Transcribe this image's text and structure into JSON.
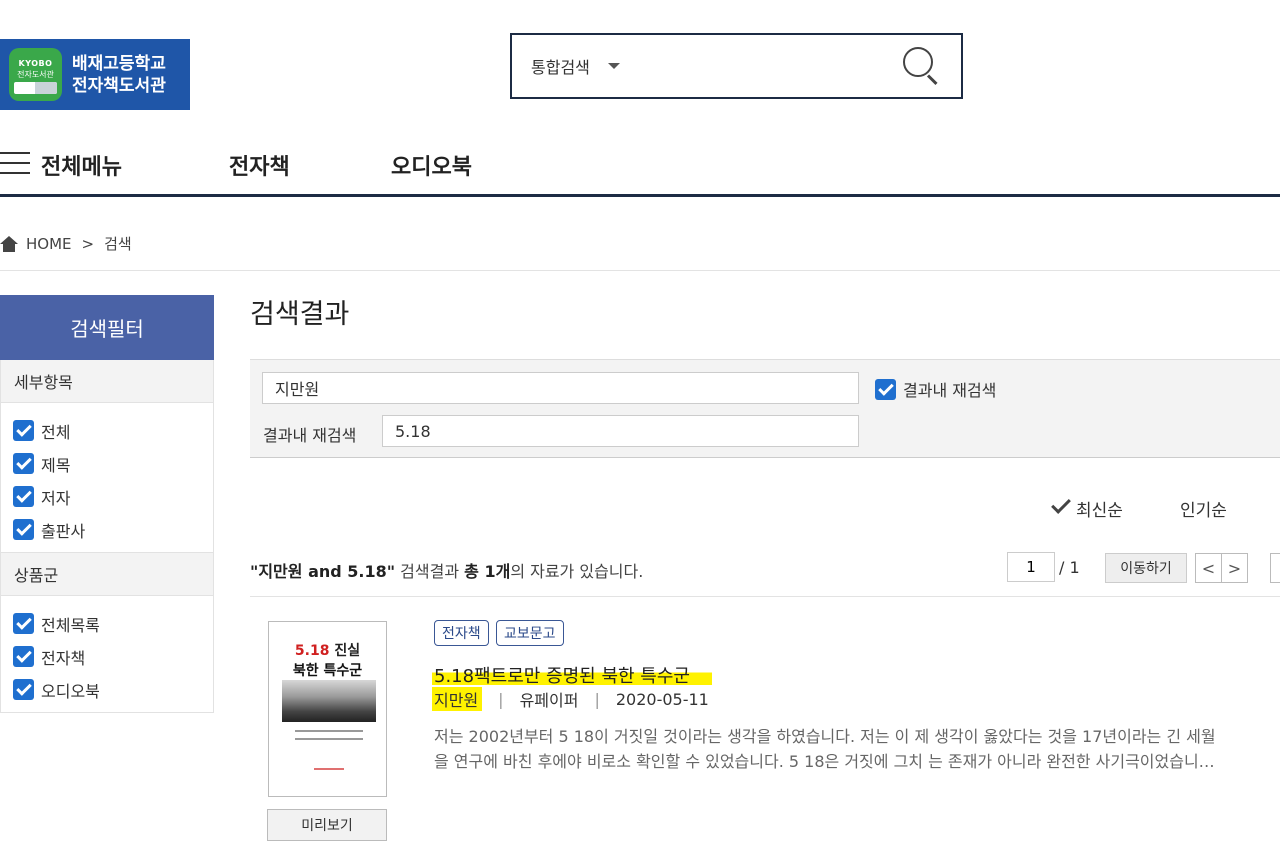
{
  "header": {
    "logo_badge_line1": "KYOBO",
    "logo_badge_line2": "전자도서관",
    "logo_line1": "배재고등학교",
    "logo_line2": "전자책도서관",
    "search_type": "통합검색",
    "search_value": "",
    "search_icon": "search-icon"
  },
  "nav": {
    "menu_icon": "hamburger-icon",
    "items": [
      "전체메뉴",
      "전자책",
      "오디오북"
    ]
  },
  "breadcrumb": {
    "home_icon": "home-icon",
    "home": "HOME",
    "separator": ">",
    "current": "검색"
  },
  "sidebar": {
    "title": "검색필터",
    "groups": [
      {
        "heading": "세부항목",
        "items": [
          "전체",
          "제목",
          "저자",
          "출판사"
        ]
      },
      {
        "heading": "상품군",
        "items": [
          "전체목록",
          "전자책",
          "오디오북"
        ]
      }
    ]
  },
  "main": {
    "title": "검색결과",
    "refine": {
      "query": "지만원",
      "within_label": "결과내 재검색",
      "within_value": "5.18",
      "checkbox_label": "결과내 재검색"
    },
    "sort": {
      "latest": "최신순",
      "popular": "인기순"
    },
    "summary": {
      "query_text": "\"지만원 and 5.18\"",
      "text1": " 검색결과 ",
      "count_text": "총 1개",
      "text2": "의 자료가 있습니다."
    },
    "pagination": {
      "current": "1",
      "total": "/ 1",
      "go_label": "이동하기",
      "prev": "<",
      "next": ">"
    },
    "results": [
      {
        "cover": {
          "line1_red": "5.18",
          "line1_rest": " 진실",
          "line2": "북한 특수군"
        },
        "preview_label": "미리보기",
        "tags": [
          "전자책",
          "교보문고"
        ],
        "title": "5.18팩트로만 증명된 북한 특수군",
        "author": "지만원",
        "publisher": "유페이퍼",
        "date": "2020-05-11",
        "meta_sep": "|",
        "description": "저는 2002년부터 5 18이 거짓일 것이라는 생각을 하였습니다. 저는 이 제 생각이 옳았다는 것을 17년이라는 긴 세월을 연구에 바친 후에야 비로소 확인할 수 있었습니다. 5 18은 거짓에 그치 는 존재가 아니라 완전한 사기극이었습니…"
      }
    ]
  },
  "colors": {
    "logo_bg": "#1f56a8",
    "filter_header": "#4a62a6",
    "checkbox": "#1f6fcf",
    "highlight": "#fff200",
    "nav_border": "#1c2b44"
  }
}
